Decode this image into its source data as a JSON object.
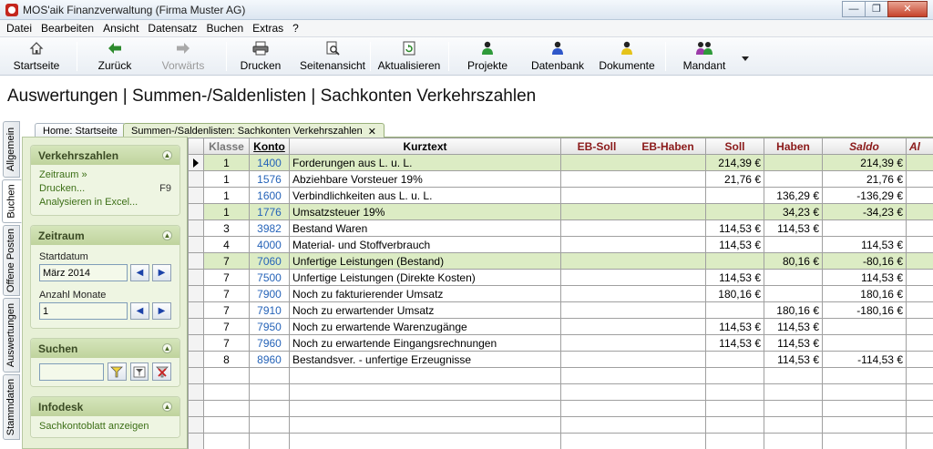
{
  "window": {
    "title": "MOS'aik Finanzverwaltung (Firma Muster AG)"
  },
  "menu": [
    "Datei",
    "Bearbeiten",
    "Ansicht",
    "Datensatz",
    "Buchen",
    "Extras",
    "?"
  ],
  "toolbar": {
    "startseite": "Startseite",
    "zurueck": "Zurück",
    "vorwaerts": "Vorwärts",
    "drucken": "Drucken",
    "seitenansicht": "Seitenansicht",
    "aktualisieren": "Aktualisieren",
    "projekte": "Projekte",
    "datenbank": "Datenbank",
    "dokumente": "Dokumente",
    "mandant": "Mandant"
  },
  "page_title": "Auswertungen | Summen-/Saldenlisten | Sachkonten Verkehrszahlen",
  "vertical_tabs": [
    "Allgemein",
    "Buchen",
    "Offene Posten",
    "Auswertungen",
    "Stammdaten"
  ],
  "doc_tabs": [
    "Home: Startseite",
    "Summen-/Saldenlisten: Sachkonten Verkehrszahlen"
  ],
  "side": {
    "verkehrszahlen": {
      "title": "Verkehrszahlen",
      "links": [
        "Zeitraum »",
        "Drucken...",
        "Analysieren in Excel..."
      ],
      "drucken_key": "F9"
    },
    "zeitraum": {
      "title": "Zeitraum",
      "start_label": "Startdatum",
      "start_value": "März 2014",
      "months_label": "Anzahl Monate",
      "months_value": "1"
    },
    "suchen": {
      "title": "Suchen",
      "value": ""
    },
    "infodesk": {
      "title": "Infodesk",
      "link": "Sachkontoblatt anzeigen"
    }
  },
  "columns": {
    "klasse": "Klasse",
    "konto": "Konto",
    "kurztext": "Kurztext",
    "eb_soll": "EB-Soll",
    "eb_haben": "EB-Haben",
    "soll": "Soll",
    "haben": "Haben",
    "saldo": "Saldo",
    "extra": "Al"
  },
  "rows": [
    {
      "klasse": "1",
      "konto": "1400",
      "kurztext": "Forderungen aus L. u. L.",
      "soll": "214,39 €",
      "haben": "",
      "saldo": "214,39 €",
      "highlight": true
    },
    {
      "klasse": "1",
      "konto": "1576",
      "kurztext": "Abziehbare Vorsteuer 19%",
      "soll": "21,76 €",
      "haben": "",
      "saldo": "21,76 €",
      "highlight": false
    },
    {
      "klasse": "1",
      "konto": "1600",
      "kurztext": "Verbindlichkeiten aus L. u. L.",
      "soll": "",
      "haben": "136,29 €",
      "saldo": "-136,29 €",
      "highlight": false
    },
    {
      "klasse": "1",
      "konto": "1776",
      "kurztext": "Umsatzsteuer 19%",
      "soll": "",
      "haben": "34,23 €",
      "saldo": "-34,23 €",
      "highlight": true
    },
    {
      "klasse": "3",
      "konto": "3982",
      "kurztext": "Bestand Waren",
      "soll": "114,53 €",
      "haben": "114,53 €",
      "saldo": "",
      "highlight": false
    },
    {
      "klasse": "4",
      "konto": "4000",
      "kurztext": "Material- und Stoffverbrauch",
      "soll": "114,53 €",
      "haben": "",
      "saldo": "114,53 €",
      "highlight": false
    },
    {
      "klasse": "7",
      "konto": "7060",
      "kurztext": "Unfertige Leistungen (Bestand)",
      "soll": "",
      "haben": "80,16 €",
      "saldo": "-80,16 €",
      "highlight": true
    },
    {
      "klasse": "7",
      "konto": "7500",
      "kurztext": "Unfertige Leistungen (Direkte Kosten)",
      "soll": "114,53 €",
      "haben": "",
      "saldo": "114,53 €",
      "highlight": false
    },
    {
      "klasse": "7",
      "konto": "7900",
      "kurztext": "Noch zu fakturierender Umsatz",
      "soll": "180,16 €",
      "haben": "",
      "saldo": "180,16 €",
      "highlight": false
    },
    {
      "klasse": "7",
      "konto": "7910",
      "kurztext": "Noch zu erwartender Umsatz",
      "soll": "",
      "haben": "180,16 €",
      "saldo": "-180,16 €",
      "highlight": false
    },
    {
      "klasse": "7",
      "konto": "7950",
      "kurztext": "Noch zu erwartende Warenzugänge",
      "soll": "114,53 €",
      "haben": "114,53 €",
      "saldo": "",
      "highlight": false
    },
    {
      "klasse": "7",
      "konto": "7960",
      "kurztext": "Noch zu erwartende Eingangsrechnungen",
      "soll": "114,53 €",
      "haben": "114,53 €",
      "saldo": "",
      "highlight": false
    },
    {
      "klasse": "8",
      "konto": "8960",
      "kurztext": "Bestandsver. - unfertige Erzeugnisse",
      "soll": "",
      "haben": "114,53 €",
      "saldo": "-114,53 €",
      "highlight": false
    }
  ],
  "icons": {
    "home": "home-icon",
    "back": "arrow-left-icon",
    "forward": "arrow-right-icon",
    "print": "printer-icon",
    "preview": "page-preview-icon",
    "refresh": "refresh-icon",
    "projects": "person-green-icon",
    "database": "person-blue-icon",
    "documents": "person-yellow-icon",
    "mandant": "people-icon"
  }
}
